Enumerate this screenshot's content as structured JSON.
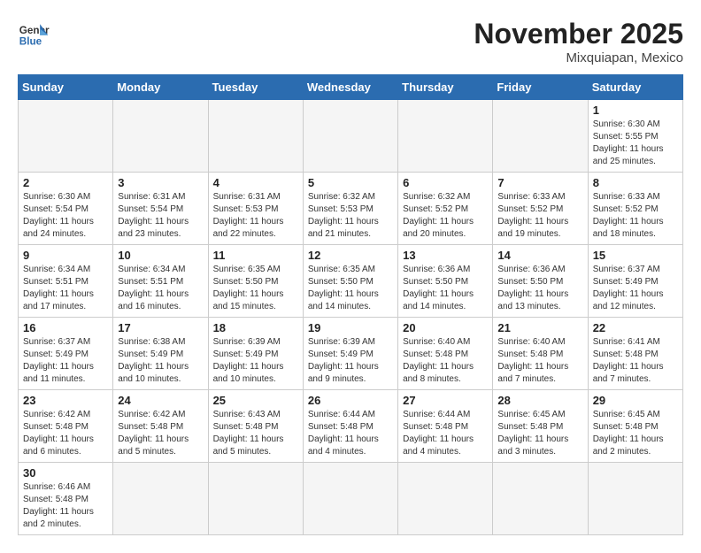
{
  "header": {
    "logo_general": "General",
    "logo_blue": "Blue",
    "month_title": "November 2025",
    "location": "Mixquiapan, Mexico"
  },
  "weekdays": [
    "Sunday",
    "Monday",
    "Tuesday",
    "Wednesday",
    "Thursday",
    "Friday",
    "Saturday"
  ],
  "weeks": [
    [
      {
        "day": "",
        "info": ""
      },
      {
        "day": "",
        "info": ""
      },
      {
        "day": "",
        "info": ""
      },
      {
        "day": "",
        "info": ""
      },
      {
        "day": "",
        "info": ""
      },
      {
        "day": "",
        "info": ""
      },
      {
        "day": "1",
        "info": "Sunrise: 6:30 AM\nSunset: 5:55 PM\nDaylight: 11 hours\nand 25 minutes."
      }
    ],
    [
      {
        "day": "2",
        "info": "Sunrise: 6:30 AM\nSunset: 5:54 PM\nDaylight: 11 hours\nand 24 minutes."
      },
      {
        "day": "3",
        "info": "Sunrise: 6:31 AM\nSunset: 5:54 PM\nDaylight: 11 hours\nand 23 minutes."
      },
      {
        "day": "4",
        "info": "Sunrise: 6:31 AM\nSunset: 5:53 PM\nDaylight: 11 hours\nand 22 minutes."
      },
      {
        "day": "5",
        "info": "Sunrise: 6:32 AM\nSunset: 5:53 PM\nDaylight: 11 hours\nand 21 minutes."
      },
      {
        "day": "6",
        "info": "Sunrise: 6:32 AM\nSunset: 5:52 PM\nDaylight: 11 hours\nand 20 minutes."
      },
      {
        "day": "7",
        "info": "Sunrise: 6:33 AM\nSunset: 5:52 PM\nDaylight: 11 hours\nand 19 minutes."
      },
      {
        "day": "8",
        "info": "Sunrise: 6:33 AM\nSunset: 5:52 PM\nDaylight: 11 hours\nand 18 minutes."
      }
    ],
    [
      {
        "day": "9",
        "info": "Sunrise: 6:34 AM\nSunset: 5:51 PM\nDaylight: 11 hours\nand 17 minutes."
      },
      {
        "day": "10",
        "info": "Sunrise: 6:34 AM\nSunset: 5:51 PM\nDaylight: 11 hours\nand 16 minutes."
      },
      {
        "day": "11",
        "info": "Sunrise: 6:35 AM\nSunset: 5:50 PM\nDaylight: 11 hours\nand 15 minutes."
      },
      {
        "day": "12",
        "info": "Sunrise: 6:35 AM\nSunset: 5:50 PM\nDaylight: 11 hours\nand 14 minutes."
      },
      {
        "day": "13",
        "info": "Sunrise: 6:36 AM\nSunset: 5:50 PM\nDaylight: 11 hours\nand 14 minutes."
      },
      {
        "day": "14",
        "info": "Sunrise: 6:36 AM\nSunset: 5:50 PM\nDaylight: 11 hours\nand 13 minutes."
      },
      {
        "day": "15",
        "info": "Sunrise: 6:37 AM\nSunset: 5:49 PM\nDaylight: 11 hours\nand 12 minutes."
      }
    ],
    [
      {
        "day": "16",
        "info": "Sunrise: 6:37 AM\nSunset: 5:49 PM\nDaylight: 11 hours\nand 11 minutes."
      },
      {
        "day": "17",
        "info": "Sunrise: 6:38 AM\nSunset: 5:49 PM\nDaylight: 11 hours\nand 10 minutes."
      },
      {
        "day": "18",
        "info": "Sunrise: 6:39 AM\nSunset: 5:49 PM\nDaylight: 11 hours\nand 10 minutes."
      },
      {
        "day": "19",
        "info": "Sunrise: 6:39 AM\nSunset: 5:49 PM\nDaylight: 11 hours\nand 9 minutes."
      },
      {
        "day": "20",
        "info": "Sunrise: 6:40 AM\nSunset: 5:48 PM\nDaylight: 11 hours\nand 8 minutes."
      },
      {
        "day": "21",
        "info": "Sunrise: 6:40 AM\nSunset: 5:48 PM\nDaylight: 11 hours\nand 7 minutes."
      },
      {
        "day": "22",
        "info": "Sunrise: 6:41 AM\nSunset: 5:48 PM\nDaylight: 11 hours\nand 7 minutes."
      }
    ],
    [
      {
        "day": "23",
        "info": "Sunrise: 6:42 AM\nSunset: 5:48 PM\nDaylight: 11 hours\nand 6 minutes."
      },
      {
        "day": "24",
        "info": "Sunrise: 6:42 AM\nSunset: 5:48 PM\nDaylight: 11 hours\nand 5 minutes."
      },
      {
        "day": "25",
        "info": "Sunrise: 6:43 AM\nSunset: 5:48 PM\nDaylight: 11 hours\nand 5 minutes."
      },
      {
        "day": "26",
        "info": "Sunrise: 6:44 AM\nSunset: 5:48 PM\nDaylight: 11 hours\nand 4 minutes."
      },
      {
        "day": "27",
        "info": "Sunrise: 6:44 AM\nSunset: 5:48 PM\nDaylight: 11 hours\nand 4 minutes."
      },
      {
        "day": "28",
        "info": "Sunrise: 6:45 AM\nSunset: 5:48 PM\nDaylight: 11 hours\nand 3 minutes."
      },
      {
        "day": "29",
        "info": "Sunrise: 6:45 AM\nSunset: 5:48 PM\nDaylight: 11 hours\nand 2 minutes."
      }
    ],
    [
      {
        "day": "30",
        "info": "Sunrise: 6:46 AM\nSunset: 5:48 PM\nDaylight: 11 hours\nand 2 minutes."
      },
      {
        "day": "",
        "info": ""
      },
      {
        "day": "",
        "info": ""
      },
      {
        "day": "",
        "info": ""
      },
      {
        "day": "",
        "info": ""
      },
      {
        "day": "",
        "info": ""
      },
      {
        "day": "",
        "info": ""
      }
    ]
  ]
}
